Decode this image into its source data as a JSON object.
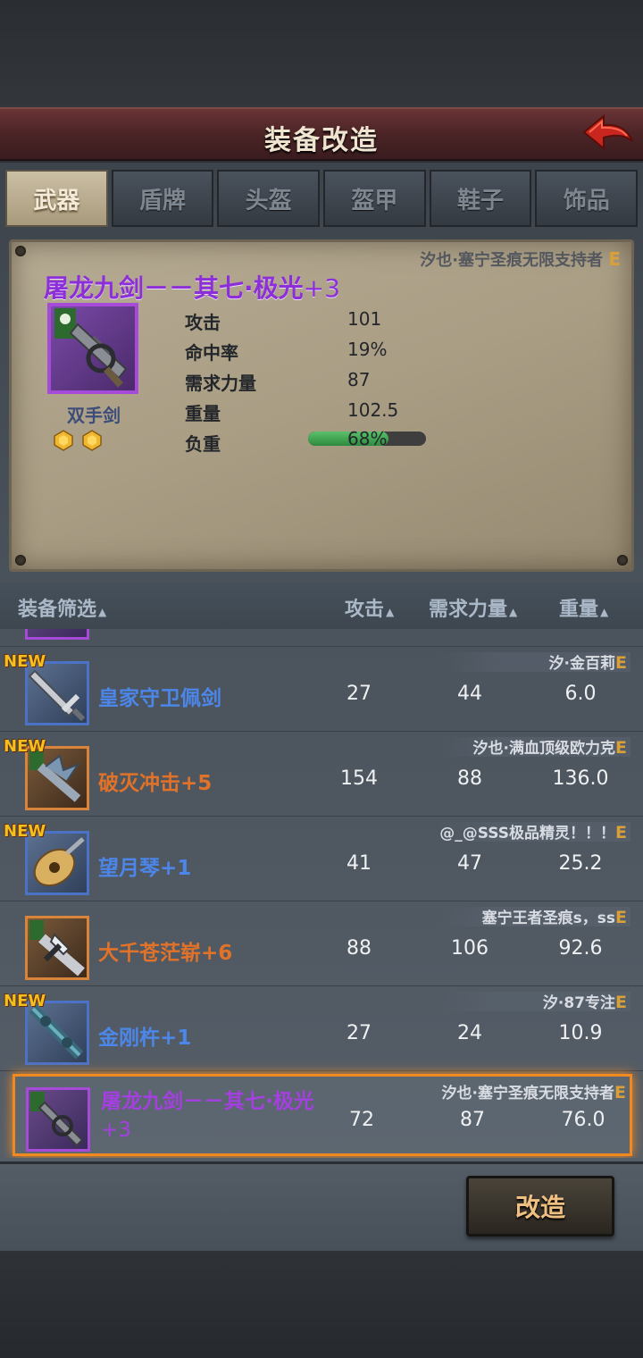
{
  "header": {
    "title": "装备改造"
  },
  "tabs": [
    {
      "label": "武器",
      "active": true
    },
    {
      "label": "盾牌",
      "active": false
    },
    {
      "label": "头盔",
      "active": false
    },
    {
      "label": "盔甲",
      "active": false
    },
    {
      "label": "鞋子",
      "active": false
    },
    {
      "label": "饰品",
      "active": false
    }
  ],
  "detail": {
    "owner": "汐也·塞宁圣痕无限支持者",
    "owner_grade": "E",
    "name": "屠龙九剑－－其七·极光",
    "name_plus": "+3",
    "type": "双手剑",
    "gems": [
      "gold-gem-icon",
      "gold-gem-icon"
    ],
    "stats": [
      {
        "label": "攻击",
        "value": "101"
      },
      {
        "label": "命中率",
        "value": "19%"
      },
      {
        "label": "需求力量",
        "value": "87"
      },
      {
        "label": "重量",
        "value": "102.5"
      }
    ],
    "load_label": "负重",
    "load_text": "68%",
    "load_fraction": 0.68
  },
  "filter": {
    "label": "装备筛选",
    "col_attack": "攻击",
    "col_strength": "需求力量",
    "col_weight": "重量",
    "sort_arrow": "▲"
  },
  "items": [
    {
      "new": "NEW",
      "owner": "汐·金百莉",
      "grade": "E",
      "name": "皇家守卫佩剑",
      "plus": "",
      "rarity": "blue",
      "attack": "27",
      "strength": "44",
      "weight": "6.0"
    },
    {
      "new": "NEW",
      "owner": "汐也·满血顶级欧力克",
      "grade": "E",
      "name": "破灭冲击",
      "plus": "+5",
      "rarity": "orange",
      "attack": "154",
      "strength": "88",
      "weight": "136.0"
    },
    {
      "new": "NEW",
      "owner": "@_@SSS极品精灵！！！",
      "grade": "E",
      "name": "望月琴",
      "plus": "+1",
      "rarity": "blue",
      "attack": "41",
      "strength": "47",
      "weight": "25.2"
    },
    {
      "new": "",
      "owner": "塞宁王者圣痕s，ss",
      "grade": "E",
      "name": "大千苍茫崭",
      "plus": "+6",
      "rarity": "orange",
      "attack": "88",
      "strength": "106",
      "weight": "92.6"
    },
    {
      "new": "NEW",
      "owner": "汐·87专注",
      "grade": "E",
      "name": "金刚杵",
      "plus": "+1",
      "rarity": "blue",
      "attack": "27",
      "strength": "24",
      "weight": "10.9"
    },
    {
      "new": "",
      "owner": "汐也·塞宁圣痕无限支持者",
      "grade": "E",
      "name": "屠龙九剑－－其七·极光",
      "plus": "+3",
      "rarity": "purple",
      "attack": "72",
      "strength": "87",
      "weight": "76.0"
    }
  ],
  "forge_button": "改造"
}
